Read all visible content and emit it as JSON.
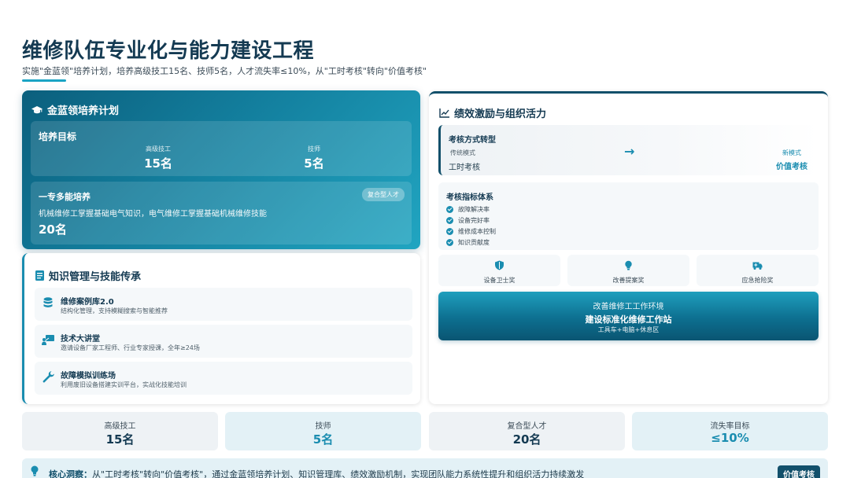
{
  "page": {
    "title": "维修队伍专业化与能力建设工程",
    "subtitle": "实施\"金蓝领\"培养计划，培养高级技工15名、技师5名，人才流失率≤10%，从\"工时考核\"转向\"价值考核\""
  },
  "training": {
    "header": "金蓝领培养计划",
    "icon": "graduation-cap-icon",
    "goal": {
      "label": "培养目标",
      "stats": [
        {
          "key": "高级技工",
          "value": "15名"
        },
        {
          "key": "技师",
          "value": "5名"
        }
      ]
    },
    "multi": {
      "label": "一专多能培养",
      "badge": "复合型人才",
      "desc": "机械维修工掌握基础电气知识，电气维修工掌握基础机械维修技能",
      "value": "20名"
    }
  },
  "knowledge": {
    "header": "知识管理与技能传承",
    "icon": "book-icon",
    "items": [
      {
        "title": "维修案例库2.0",
        "desc": "结构化管理，支持模糊搜索与智能推荐",
        "icon": "database-icon"
      },
      {
        "title": "技术大讲堂",
        "desc": "邀请设备厂家工程师、行业专家授课，全年≥24场",
        "icon": "lecture-icon"
      },
      {
        "title": "故障模拟训练场",
        "desc": "利用废旧设备搭建实训平台，实战化技能培训",
        "icon": "wrench-icon"
      }
    ]
  },
  "performance": {
    "header": "绩效激励与组织活力",
    "icon": "chart-line-icon",
    "mode": {
      "title": "考核方式转型",
      "old_key": "传统模式",
      "old_value": "工时考核",
      "arrow": "→",
      "new_key": "新模式",
      "new_value": "价值考核"
    },
    "metrics": {
      "title": "考核指标体系",
      "items": [
        "故障解决率",
        "设备完好率",
        "维修成本控制",
        "知识贡献度"
      ]
    },
    "awards": [
      {
        "label": "设备卫士奖",
        "icon": "shield-icon"
      },
      {
        "label": "改善提案奖",
        "icon": "lightbulb-icon"
      },
      {
        "label": "应急抢险奖",
        "icon": "ambulance-icon"
      }
    ],
    "env": {
      "line1": "改善维修工工作环境",
      "line2": "建设标准化维修工作站",
      "line3": "工具车+电脑+休息区"
    }
  },
  "bottom_stats": [
    {
      "key": "高级技工",
      "value": "15名"
    },
    {
      "key": "技师",
      "value": "5名"
    },
    {
      "key": "复合型人才",
      "value": "20名"
    },
    {
      "key": "流失率目标",
      "value": "≤10%"
    }
  ],
  "insight": {
    "label": "核心洞察：",
    "text": "从\"工时考核\"转向\"价值考核\"，通过金蓝领培养计划、知识管理库、绩效激励机制，实现团队能力系统性提升和组织活力持续激发",
    "tag": "价值考核"
  },
  "colors": {
    "primary_dark": "#12506b",
    "accent": "#1a8db0",
    "title": "#143a52"
  }
}
